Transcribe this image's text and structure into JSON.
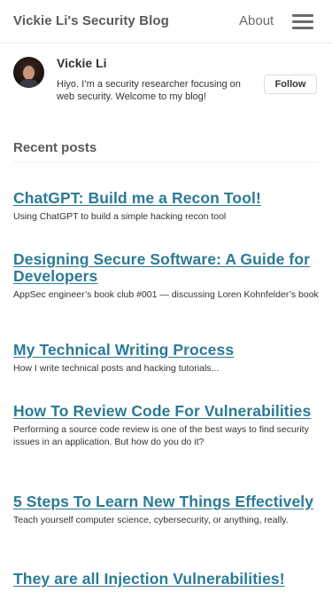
{
  "header": {
    "site_title": "Vickie Li's Security Blog",
    "about_label": "About"
  },
  "profile": {
    "name": "Vickie Li",
    "bio": "Hiyo. I’m a security researcher focusing on web security. Welcome to my blog!",
    "follow_label": "Follow"
  },
  "recent": {
    "heading": "Recent posts"
  },
  "posts": [
    {
      "title": "ChatGPT: Build me a Recon Tool!",
      "excerpt": "Using ChatGPT to build a simple hacking recon tool"
    },
    {
      "title": "Designing Secure Software: A Guide for Developers",
      "excerpt": "AppSec engineer’s book club #001 — discussing Loren Kohnfelder’s book"
    },
    {
      "title": "My Technical Writing Process",
      "excerpt": "How I write technical posts and hacking tutorials..."
    },
    {
      "title": "How To Review Code For Vulnerabilities",
      "excerpt": "Performing a source code review is one of the best ways to find security issues in an application. But how do you do it?"
    },
    {
      "title": "5 Steps To Learn New Things Effectively",
      "excerpt": "Teach yourself computer science, cybersecurity, or anything, really."
    },
    {
      "title": "They are all Injection Vulnerabilities!",
      "excerpt": ""
    }
  ],
  "icons": {
    "menu": "hamburger-menu-icon",
    "avatar": "author-avatar"
  },
  "colors": {
    "link": "#2b7a95",
    "text": "#242424",
    "muted": "#5a5a5a"
  }
}
